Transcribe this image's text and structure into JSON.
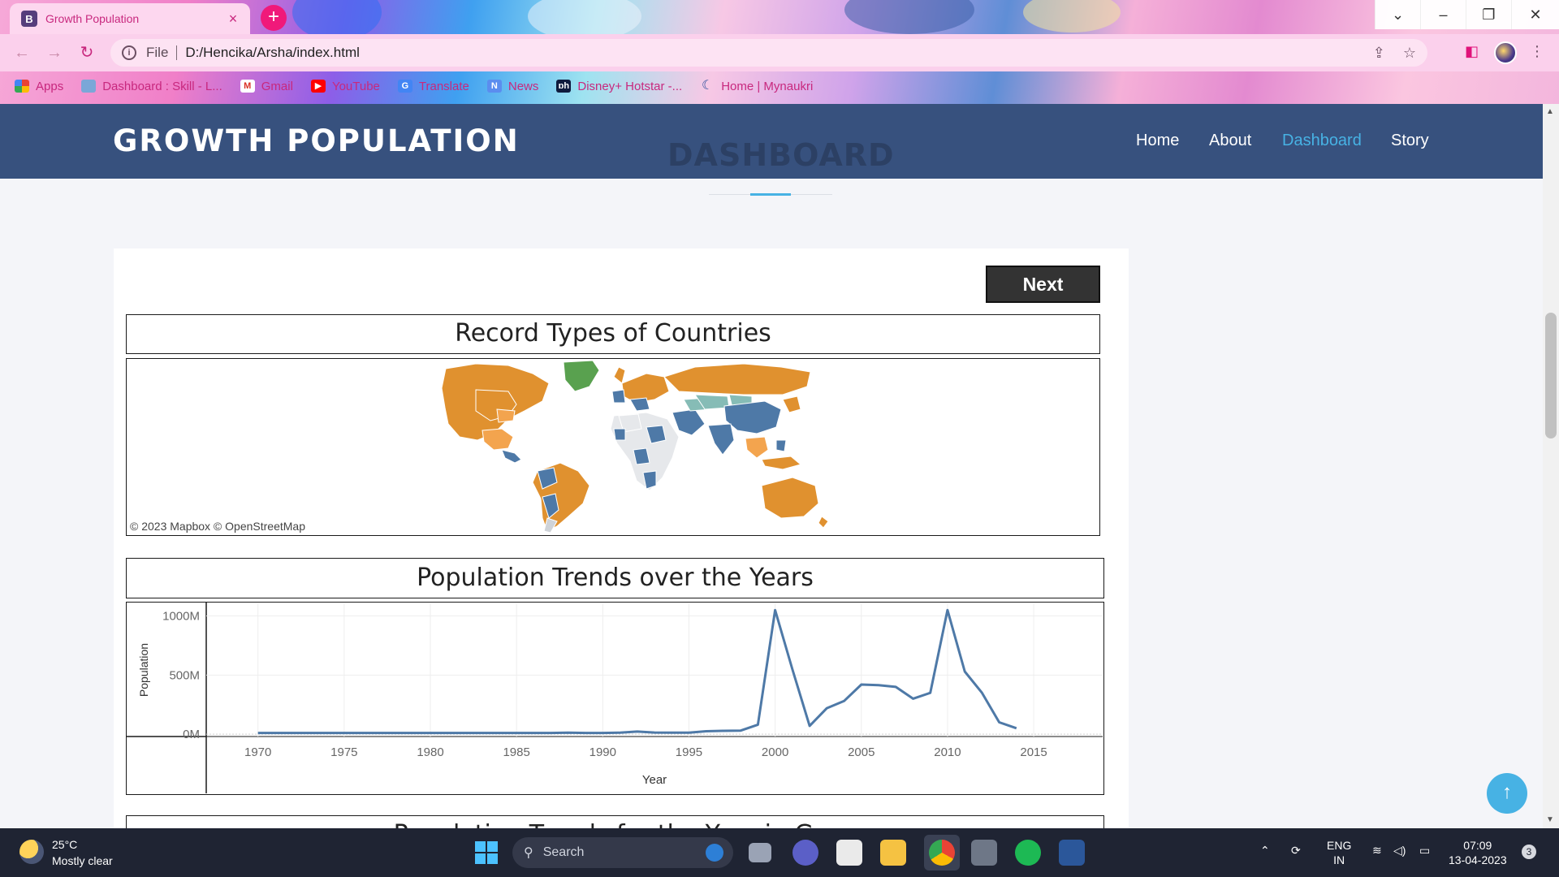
{
  "browser": {
    "tab_title": "Growth Population",
    "tab_favicon": "B",
    "url_prefix": "File",
    "url": "D:/Hencika/Arsha/index.html",
    "bookmarks": [
      {
        "label": "Apps",
        "icon": "apps-grid-icon"
      },
      {
        "label": "Dashboard : Skill - L...",
        "icon": "skill-icon"
      },
      {
        "label": "Gmail",
        "icon": "gmail-icon"
      },
      {
        "label": "YouTube",
        "icon": "youtube-icon"
      },
      {
        "label": "Translate",
        "icon": "translate-icon"
      },
      {
        "label": "News",
        "icon": "news-icon"
      },
      {
        "label": "Disney+ Hotstar -...",
        "icon": "hotstar-icon"
      },
      {
        "label": "Home | Mynaukri",
        "icon": "mynaukri-icon"
      }
    ]
  },
  "site": {
    "logo": "GROWTH POPULATION",
    "ghost_heading": "DASHBOARD",
    "nav": [
      {
        "label": "Home",
        "active": false
      },
      {
        "label": "About",
        "active": false
      },
      {
        "label": "Dashboard",
        "active": true
      },
      {
        "label": "Story",
        "active": false
      }
    ],
    "next_button": "Next",
    "map_title": "Record Types of Countries",
    "map_credit": "© 2023 Mapbox  © OpenStreetMap",
    "trend_title": "Population Trends over the Years",
    "third_title_partial": "Population Trends for the Year in G..."
  },
  "chart_data": {
    "type": "line",
    "title": "Population Trends over the Years",
    "xlabel": "Year",
    "ylabel": "Population",
    "x_ticks": [
      "1970",
      "1975",
      "1980",
      "1985",
      "1990",
      "1995",
      "2000",
      "2005",
      "2010",
      "2015"
    ],
    "y_ticks": [
      "0M",
      "500M",
      "1000M"
    ],
    "xlim": [
      1967,
      2019
    ],
    "ylim": [
      -20,
      1100
    ],
    "grid": true,
    "color": "#4e79a7",
    "series": [
      {
        "x": [
          1970,
          1975,
          1980,
          1985,
          1987,
          1988,
          1989,
          1990,
          1991,
          1992,
          1993,
          1994,
          1995,
          1996,
          1997,
          1998,
          1999,
          2000,
          2001,
          2002,
          2003,
          2004,
          2005,
          2006,
          2007,
          2008,
          2009,
          2010,
          2011,
          2012,
          2013,
          2014
        ],
        "y": [
          10,
          10,
          10,
          10,
          10,
          12,
          10,
          10,
          12,
          22,
          14,
          12,
          12,
          25,
          28,
          30,
          80,
          1050,
          550,
          70,
          220,
          280,
          420,
          415,
          400,
          300,
          350,
          1050,
          530,
          350,
          100,
          50
        ]
      }
    ]
  },
  "taskbar": {
    "weather_temp": "25°C",
    "weather_desc": "Mostly clear",
    "search_label": "Search",
    "lang_top": "ENG",
    "lang_bottom": "IN",
    "time": "07:09",
    "date": "13-04-2023",
    "notifications": "3"
  }
}
